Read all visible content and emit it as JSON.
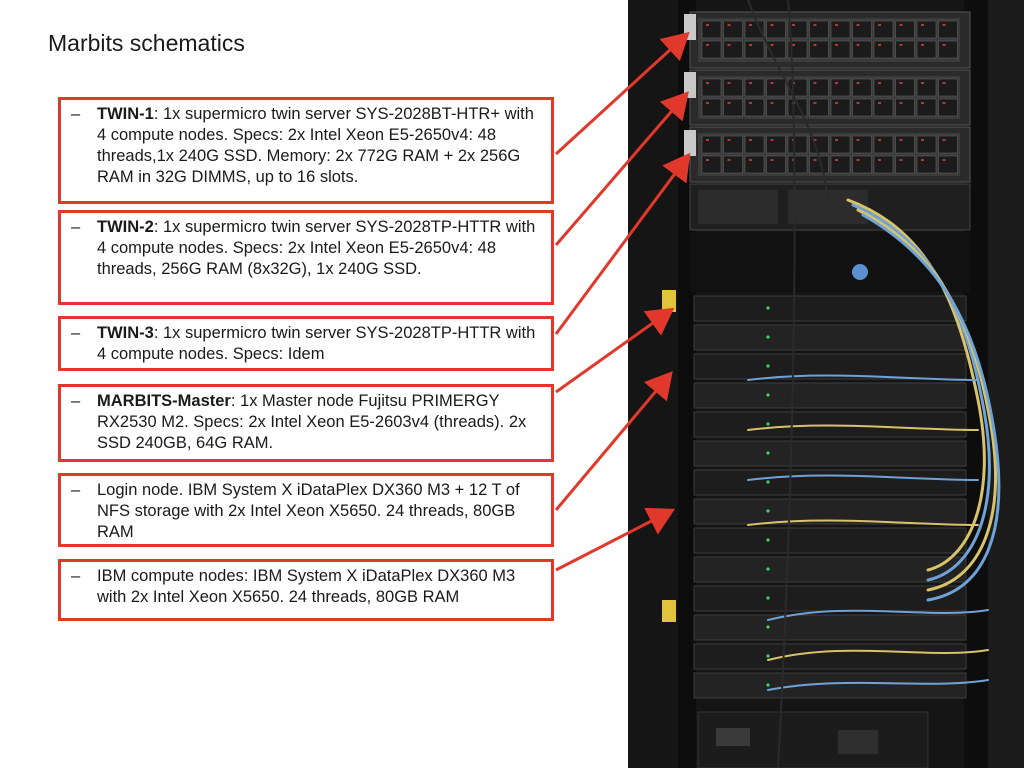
{
  "title": "Marbits schematics",
  "accent_color": "#e0382a",
  "items": [
    {
      "bold": "TWIN-1",
      "rest": ": 1x supermicro twin server SYS-2028BT-HTR+ with 4 compute nodes. Specs: 2x Intel Xeon E5-2650v4: 48 threads,1x 240G SSD. Memory: 2x 772G RAM + 2x 256G RAM in 32G DIMMS, up to 16 slots."
    },
    {
      "bold": "TWIN-2",
      "rest": ": 1x supermicro twin server SYS-2028TP-HTTR with 4 compute nodes. Specs: 2x Intel Xeon E5-2650v4: 48 threads, 256G RAM (8x32G), 1x 240G SSD."
    },
    {
      "bold": "TWIN-3",
      "rest": ": 1x supermicro twin server SYS-2028TP-HTTR with 4 compute nodes. Specs: Idem"
    },
    {
      "bold": "MARBITS-Master",
      "rest": ": 1x Master node Fujitsu PRIMERGY RX2530 M2. Specs: 2x Intel Xeon E5-2603v4 (threads). 2x SSD 240GB, 64G RAM."
    },
    {
      "bold": "",
      "rest": "Login node.  IBM System X iDataPlex DX360 M3 + 12 T of NFS storage with 2x Intel Xeon X5650. 24 threads, 80GB RAM"
    },
    {
      "bold": "",
      "rest": "IBM compute nodes: IBM System X iDataPlex DX360 M3 with 2x Intel Xeon X5650. 24 threads, 80GB RAM"
    }
  ],
  "bullet": "–"
}
